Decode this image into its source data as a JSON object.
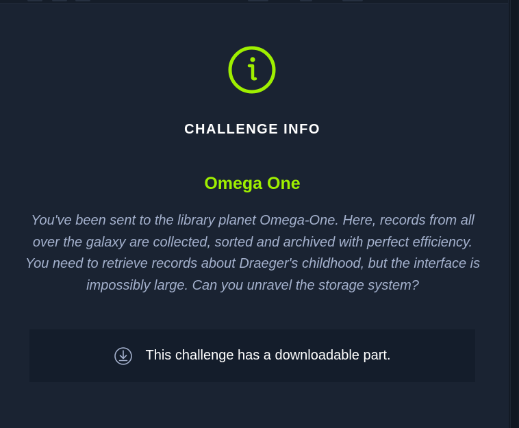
{
  "modal": {
    "title": "CHALLENGE INFO",
    "challenge_name": "Omega One",
    "description": "You've been sent to the library planet Omega-One. Here, records from all over the galaxy are collected, sorted and archived with perfect efficiency. You need to retrieve records about Draeger's childhood, but the interface is impossibly large. Can you unravel the storage system?",
    "download_text": "This challenge has a downloadable part.",
    "icons": {
      "header_icon": "info-circle-icon",
      "download_icon": "download-circle-icon"
    },
    "colors": {
      "background": "#1a2332",
      "accent": "#9fef00",
      "description_text": "#a4b1cd",
      "download_box": "#141d2b",
      "title_text": "#ffffff"
    }
  }
}
